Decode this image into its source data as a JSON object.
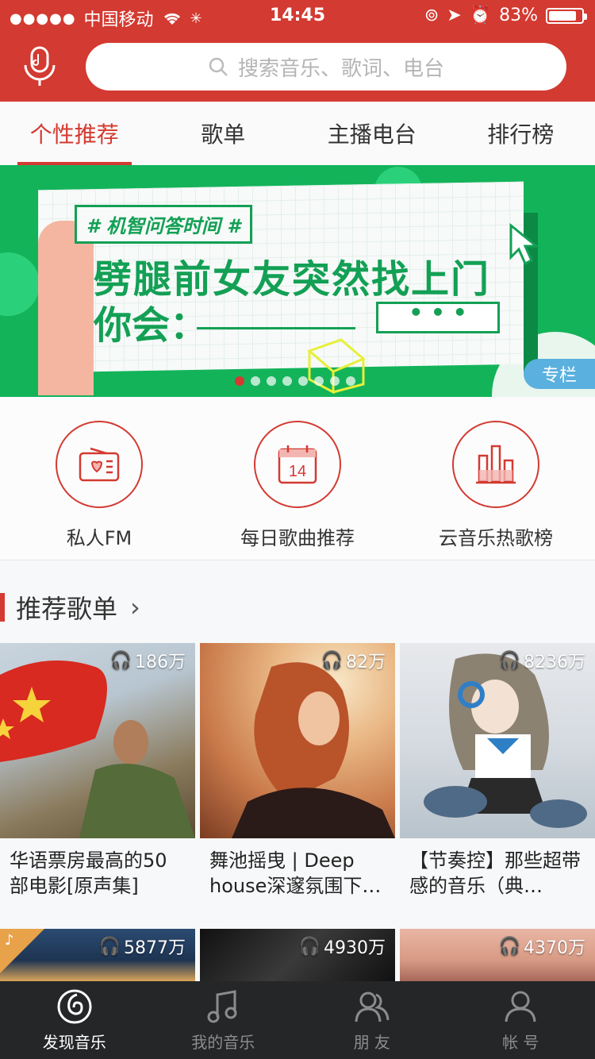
{
  "status_bar": {
    "carrier": "中国移动",
    "time": "14:45",
    "battery": "83%"
  },
  "search": {
    "placeholder": "搜索音乐、歌词、电台"
  },
  "tabs": [
    {
      "label": "个性推荐",
      "active": true
    },
    {
      "label": "歌单",
      "active": false
    },
    {
      "label": "主播电台",
      "active": false
    },
    {
      "label": "排行榜",
      "active": false
    }
  ],
  "banner": {
    "tag": "# 机智问答时间 #",
    "headline_line1": "劈腿前女友突然找上门",
    "headline_line2": "你会：",
    "bubble": "• • •",
    "corner_label": "专栏",
    "page_count": 8,
    "active_page": 1
  },
  "shortcuts": [
    {
      "label": "私人FM",
      "icon": "radio-icon"
    },
    {
      "label": "每日歌曲推荐",
      "icon": "calendar-icon",
      "day": "14"
    },
    {
      "label": "云音乐热歌榜",
      "icon": "chart-icon"
    }
  ],
  "section": {
    "title": "推荐歌单",
    "chevron": "›"
  },
  "playlists": [
    {
      "plays": "186万",
      "name": "华语票房最高的50部电影[原声集]"
    },
    {
      "plays": "82万",
      "name": "舞池摇曳 | Deep house深邃氛围下…"
    },
    {
      "plays": "8236万",
      "name": "【节奏控】那些超带感的音乐（典…"
    },
    {
      "plays": "5877万",
      "name": ""
    },
    {
      "plays": "4930万",
      "name": ""
    },
    {
      "plays": "4370万",
      "name": ""
    }
  ],
  "bottom_nav": [
    {
      "label": "发现音乐",
      "active": true,
      "icon": "netease-logo-icon"
    },
    {
      "label": "我的音乐",
      "active": false,
      "icon": "music-note-icon"
    },
    {
      "label": "朋 友",
      "active": false,
      "icon": "friends-icon"
    },
    {
      "label": "帐 号",
      "active": false,
      "icon": "account-icon"
    }
  ],
  "colors": {
    "brand_red": "#d33a31",
    "banner_green": "#13b35a",
    "nav_bg": "#252628"
  }
}
